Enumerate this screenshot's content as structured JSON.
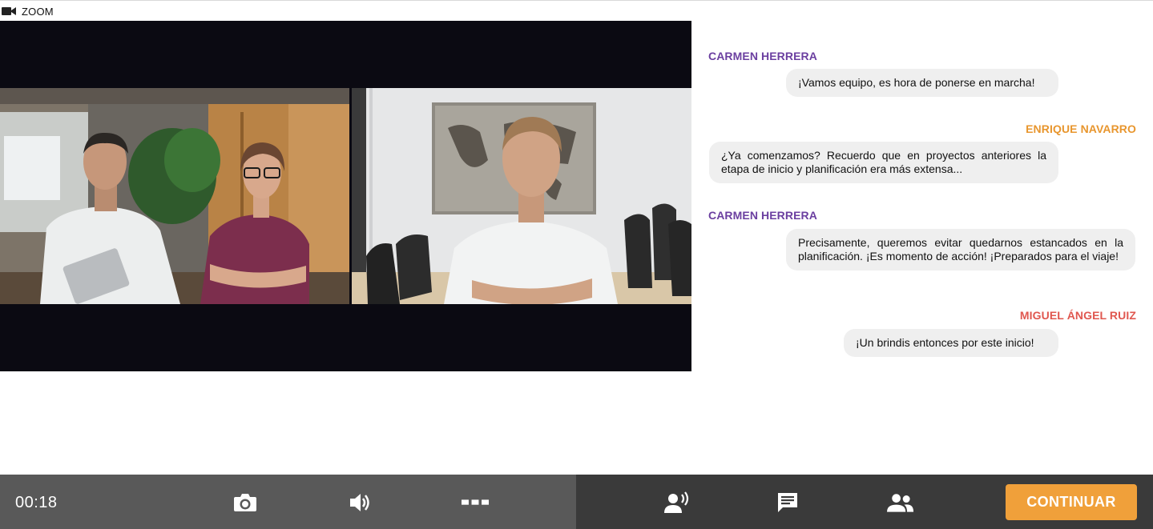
{
  "window": {
    "title": "ZOOM",
    "icon": "video-camera-icon"
  },
  "chat": {
    "messages": [
      {
        "sender": "CARMEN HERRERA",
        "sender_color": "#6b3fa0",
        "text": "¡Vamos equipo, es hora de ponerse en marcha!"
      },
      {
        "sender": "ENRIQUE NAVARRO",
        "sender_color": "#e8962e",
        "text": "¿Ya comenzamos? Recuerdo que en proyectos anteriores la etapa de inicio y planificación era más extensa..."
      },
      {
        "sender": "CARMEN HERRERA",
        "sender_color": "#6b3fa0",
        "text": "Precisamente, queremos evitar quedarnos estancados en la planificación. ¡Es momento de acción! ¡Preparados para el viaje!"
      },
      {
        "sender": "MIGUEL ÁNGEL RUIZ",
        "sender_color": "#e0574f",
        "text": "¡Un brindis entonces por este inicio!"
      }
    ]
  },
  "controls": {
    "timer": "00:18",
    "left_icons": [
      "camera-icon",
      "speaker-icon",
      "more-icon"
    ],
    "right_icons": [
      "speaker-person-icon",
      "chat-icon",
      "participants-icon"
    ],
    "continue_label": "CONTINUAR",
    "accent": "#f0a03a"
  }
}
